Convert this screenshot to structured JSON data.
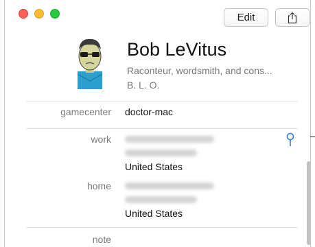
{
  "toolbar": {
    "edit_label": "Edit",
    "share_icon": "share-icon"
  },
  "contact": {
    "name": "Bob LeVitus",
    "subtitle": "Raconteur, wordsmith, and cons...",
    "initials": "B. L. O."
  },
  "fields": {
    "gamecenter": {
      "label": "gamecenter",
      "value": "doctor-mac"
    },
    "work": {
      "label": "work",
      "country": "United States"
    },
    "home": {
      "label": "home",
      "country": "United States"
    },
    "note": {
      "label": "note"
    }
  },
  "colors": {
    "accent": "#2f7bd9",
    "close": "#fd5f57",
    "minimize": "#febc2e",
    "zoom": "#28c840"
  }
}
